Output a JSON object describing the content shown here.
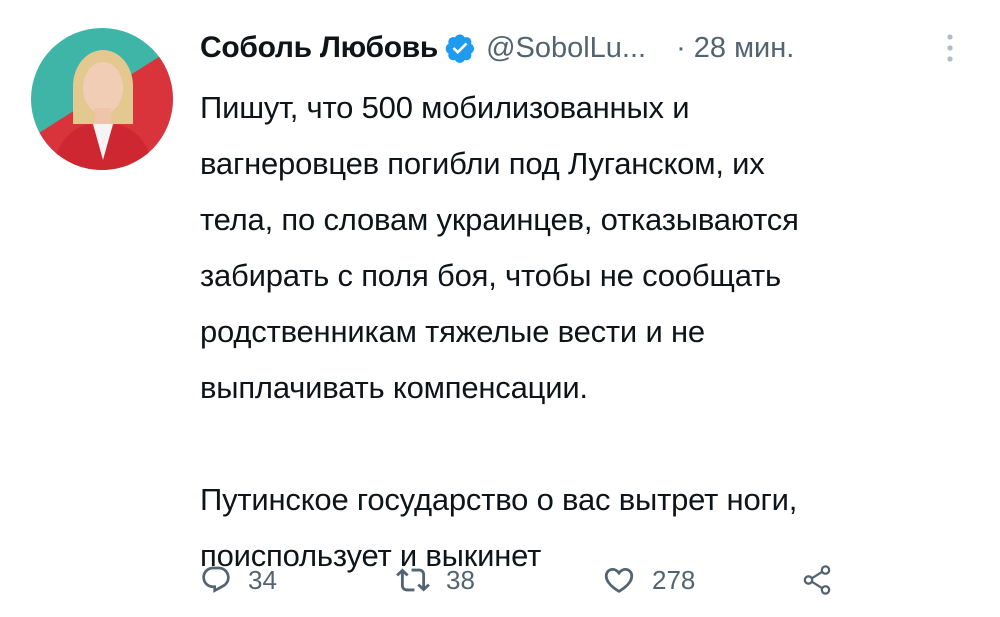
{
  "tweet": {
    "author_name": "Соболь Любовь",
    "handle": "@SobolLu...",
    "separator": "·",
    "time": "28 мин.",
    "text_paragraph_1": "Пишут, что 500 мобилизованных и\nвагнеровцев погибли под Луганском, их\nтела, по словам украинцев, отказываются\nзабирать с поля боя, чтобы не сообщать\nродственникам тяжелые вести и не\nвыплачивать компенсации.",
    "text_paragraph_2": "Путинское государство о вас вытрет ноги,\nпоиспользует и выкинет"
  },
  "actions": {
    "reply_count": "34",
    "retweet_count": "38",
    "like_count": "278"
  },
  "colors": {
    "verified": "#1d9bf0",
    "secondary_text": "#536471",
    "avatar_teal": "#3fb5a8",
    "avatar_red": "#d9343b"
  },
  "icons": {
    "avatar": "avatar-photo",
    "verified": "verified-badge-icon",
    "more": "more-vertical-icon",
    "reply": "reply-icon",
    "retweet": "retweet-icon",
    "like": "heart-icon",
    "share": "share-icon"
  }
}
